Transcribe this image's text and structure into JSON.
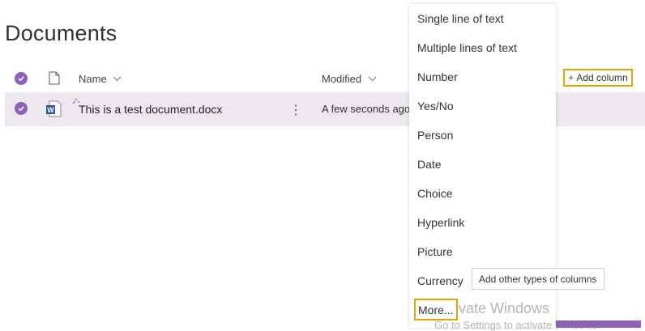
{
  "page": {
    "title": "Documents"
  },
  "columns": {
    "name": "Name",
    "modified": "Modified"
  },
  "add_column": {
    "plus": "+",
    "label": "Add column"
  },
  "document": {
    "filename": "This is a test document.docx",
    "modified": "A few seconds ago",
    "kebab": "⋮"
  },
  "menu": {
    "items": [
      "Single line of text",
      "Multiple lines of text",
      "Number",
      "Yes/No",
      "Person",
      "Date",
      "Choice",
      "Hyperlink",
      "Picture",
      "Currency"
    ],
    "more": "More..."
  },
  "tooltip": {
    "text": "Add other types of columns"
  },
  "watermark": {
    "title": "Activate Windows",
    "subtitle": "Go to Settings to activate Windows."
  },
  "colors": {
    "accent": "#8f5fbf",
    "highlight": "#e6a400",
    "row_bg": "#ede8ef"
  }
}
